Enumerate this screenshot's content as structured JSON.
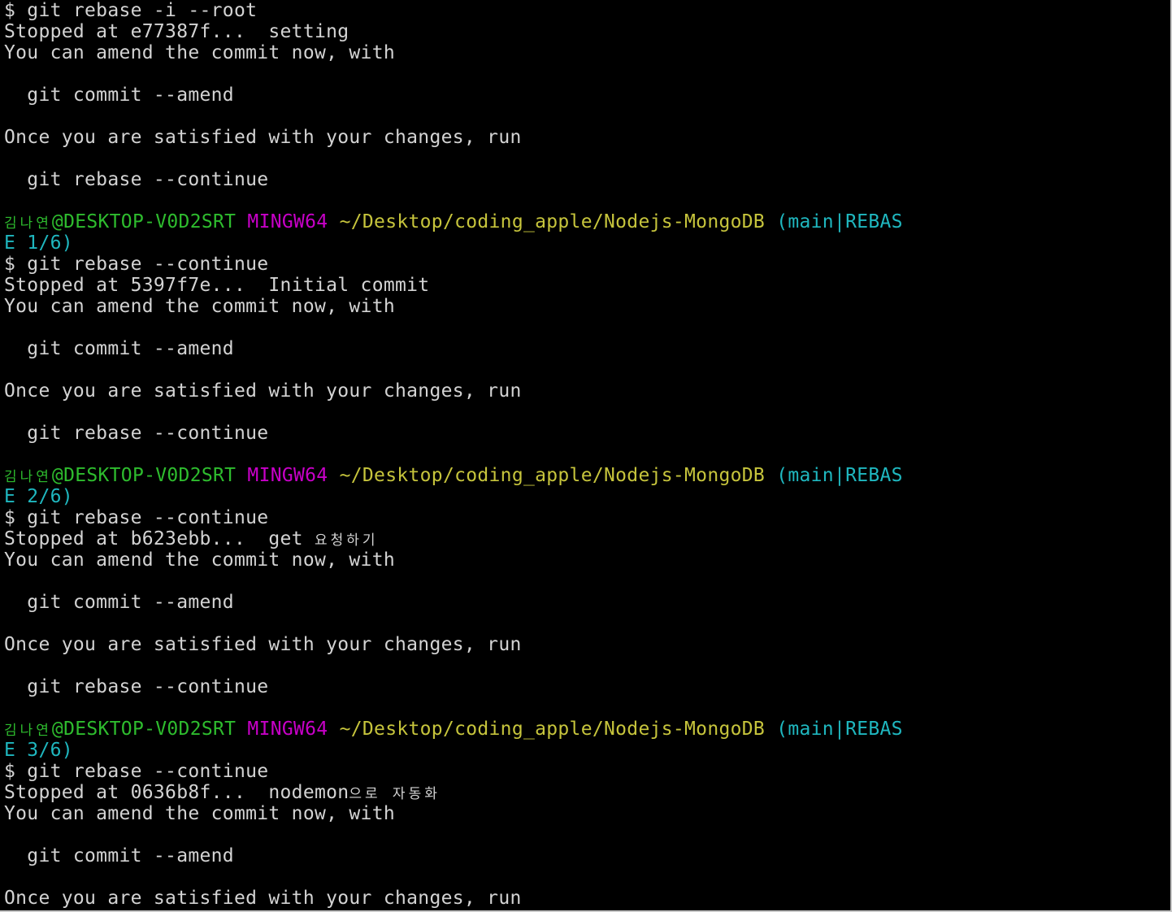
{
  "terminal": {
    "lines": [
      {
        "kind": "text",
        "segments": [
          {
            "text": "$ git rebase -i --root",
            "color": "default"
          }
        ]
      },
      {
        "kind": "text",
        "segments": [
          {
            "text": "Stopped at e77387f...  setting",
            "color": "default"
          }
        ]
      },
      {
        "kind": "text",
        "segments": [
          {
            "text": "You can amend the commit now, with",
            "color": "default"
          }
        ]
      },
      {
        "kind": "blank",
        "segments": []
      },
      {
        "kind": "text",
        "segments": [
          {
            "text": "  git commit --amend",
            "color": "default"
          }
        ]
      },
      {
        "kind": "blank",
        "segments": []
      },
      {
        "kind": "text",
        "segments": [
          {
            "text": "Once you are satisfied with your changes, run",
            "color": "default"
          }
        ]
      },
      {
        "kind": "blank",
        "segments": []
      },
      {
        "kind": "text",
        "segments": [
          {
            "text": "  git rebase --continue",
            "color": "default"
          }
        ]
      },
      {
        "kind": "blank",
        "segments": []
      },
      {
        "kind": "prompt",
        "segments": [
          {
            "text": "김나연",
            "color": "green",
            "korean": true
          },
          {
            "text": "@DESKTOP-V0D2SRT",
            "color": "green"
          },
          {
            "text": " MINGW64",
            "color": "magenta"
          },
          {
            "text": " ~/Desktop/coding_apple/Nodejs-MongoDB",
            "color": "yellow"
          },
          {
            "text": " (main|REBAS",
            "color": "cyan"
          }
        ]
      },
      {
        "kind": "prompt-cont",
        "segments": [
          {
            "text": "E 1/6)",
            "color": "cyan"
          }
        ]
      },
      {
        "kind": "text",
        "segments": [
          {
            "text": "$ git rebase --continue",
            "color": "default"
          }
        ]
      },
      {
        "kind": "text",
        "segments": [
          {
            "text": "Stopped at 5397f7e...  Initial commit",
            "color": "default"
          }
        ]
      },
      {
        "kind": "text",
        "segments": [
          {
            "text": "You can amend the commit now, with",
            "color": "default"
          }
        ]
      },
      {
        "kind": "blank",
        "segments": []
      },
      {
        "kind": "text",
        "segments": [
          {
            "text": "  git commit --amend",
            "color": "default"
          }
        ]
      },
      {
        "kind": "blank",
        "segments": []
      },
      {
        "kind": "text",
        "segments": [
          {
            "text": "Once you are satisfied with your changes, run",
            "color": "default"
          }
        ]
      },
      {
        "kind": "blank",
        "segments": []
      },
      {
        "kind": "text",
        "segments": [
          {
            "text": "  git rebase --continue",
            "color": "default"
          }
        ]
      },
      {
        "kind": "blank",
        "segments": []
      },
      {
        "kind": "prompt",
        "segments": [
          {
            "text": "김나연",
            "color": "green",
            "korean": true
          },
          {
            "text": "@DESKTOP-V0D2SRT",
            "color": "green"
          },
          {
            "text": " MINGW64",
            "color": "magenta"
          },
          {
            "text": " ~/Desktop/coding_apple/Nodejs-MongoDB",
            "color": "yellow"
          },
          {
            "text": " (main|REBAS",
            "color": "cyan"
          }
        ]
      },
      {
        "kind": "prompt-cont",
        "segments": [
          {
            "text": "E 2/6)",
            "color": "cyan"
          }
        ]
      },
      {
        "kind": "text",
        "segments": [
          {
            "text": "$ git rebase --continue",
            "color": "default"
          }
        ]
      },
      {
        "kind": "text",
        "segments": [
          {
            "text": "Stopped at b623ebb...  get ",
            "color": "default"
          },
          {
            "text": "요청하기",
            "color": "default",
            "korean": true
          }
        ]
      },
      {
        "kind": "text",
        "segments": [
          {
            "text": "You can amend the commit now, with",
            "color": "default"
          }
        ]
      },
      {
        "kind": "blank",
        "segments": []
      },
      {
        "kind": "text",
        "segments": [
          {
            "text": "  git commit --amend",
            "color": "default"
          }
        ]
      },
      {
        "kind": "blank",
        "segments": []
      },
      {
        "kind": "text",
        "segments": [
          {
            "text": "Once you are satisfied with your changes, run",
            "color": "default"
          }
        ]
      },
      {
        "kind": "blank",
        "segments": []
      },
      {
        "kind": "text",
        "segments": [
          {
            "text": "  git rebase --continue",
            "color": "default"
          }
        ]
      },
      {
        "kind": "blank",
        "segments": []
      },
      {
        "kind": "prompt",
        "segments": [
          {
            "text": "김나연",
            "color": "green",
            "korean": true
          },
          {
            "text": "@DESKTOP-V0D2SRT",
            "color": "green"
          },
          {
            "text": " MINGW64",
            "color": "magenta"
          },
          {
            "text": " ~/Desktop/coding_apple/Nodejs-MongoDB",
            "color": "yellow"
          },
          {
            "text": " (main|REBAS",
            "color": "cyan"
          }
        ]
      },
      {
        "kind": "prompt-cont",
        "segments": [
          {
            "text": "E 3/6)",
            "color": "cyan"
          }
        ]
      },
      {
        "kind": "text",
        "segments": [
          {
            "text": "$ git rebase --continue",
            "color": "default"
          }
        ]
      },
      {
        "kind": "text",
        "segments": [
          {
            "text": "Stopped at 0636b8f...  nodemon",
            "color": "default"
          },
          {
            "text": "으로 자동화",
            "color": "default",
            "korean": true
          }
        ]
      },
      {
        "kind": "text",
        "segments": [
          {
            "text": "You can amend the commit now, with",
            "color": "default"
          }
        ]
      },
      {
        "kind": "blank",
        "segments": []
      },
      {
        "kind": "text",
        "segments": [
          {
            "text": "  git commit --amend",
            "color": "default"
          }
        ]
      },
      {
        "kind": "blank",
        "segments": []
      },
      {
        "kind": "text",
        "segments": [
          {
            "text": "Once you are satisfied with your changes, run",
            "color": "default"
          }
        ]
      }
    ]
  },
  "colors": {
    "background": "#000000",
    "default": "#d3d3d3",
    "green": "#2ebc2e",
    "magenta": "#c800c8",
    "yellow": "#c6c43c",
    "cyan": "#1fb7bf"
  }
}
